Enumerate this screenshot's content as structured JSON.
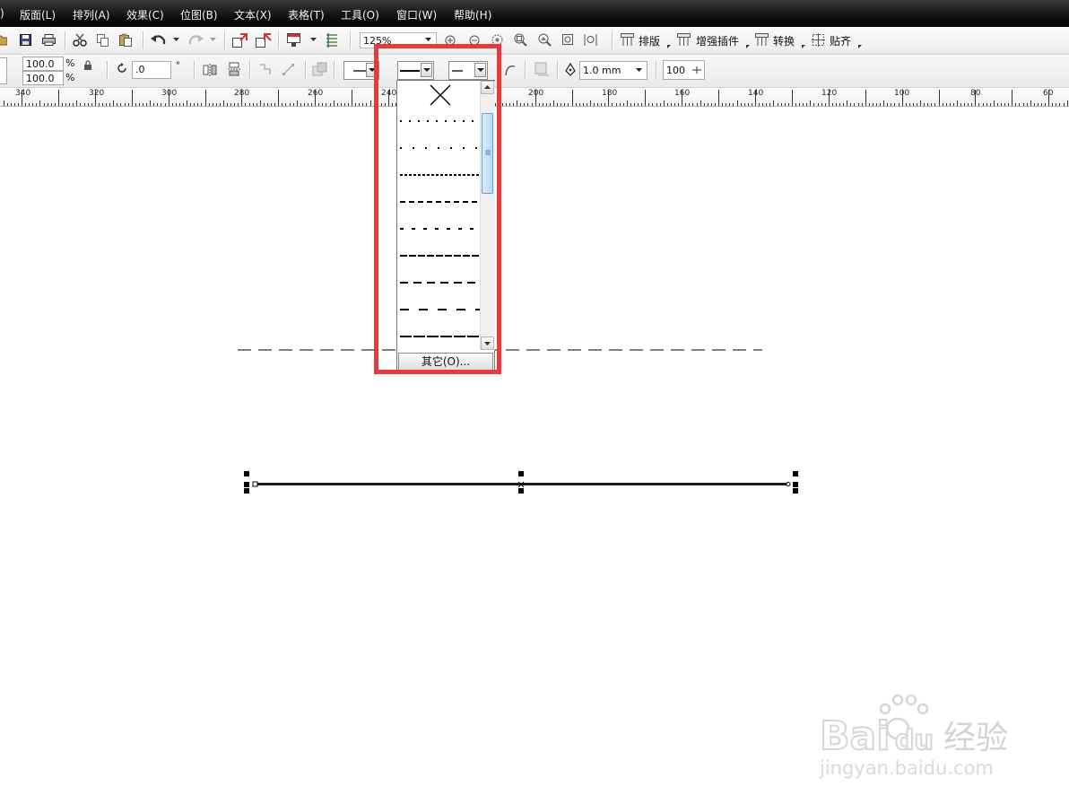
{
  "menu": {
    "items": [
      "版面(L)",
      "排列(A)",
      "效果(C)",
      "位图(B)",
      "文本(X)",
      "表格(T)",
      "工具(O)",
      "窗口(W)",
      "帮助(H)"
    ],
    "leading_fragment": ")"
  },
  "toolbar": {
    "zoom_value": "125%",
    "arrange_label": "排版",
    "plugins_label": "增强插件",
    "convert_label": "转换",
    "snap_label": "贴齐"
  },
  "property_bar": {
    "scale_x": "100.0",
    "scale_y": "100.0",
    "percent_symbol": "%",
    "rotation": ".0",
    "degree_symbol": "°",
    "outline_width": "1.0 mm",
    "opacity_value": "100"
  },
  "ruler": {
    "labels": [
      "340",
      "320",
      "300",
      "280",
      "260",
      "240",
      "200",
      "180",
      "160",
      "140",
      "120",
      "100",
      "80",
      "60"
    ]
  },
  "line_style_popup": {
    "styles": [
      "none",
      "dotted-fine",
      "dotted-sparse",
      "dotted-dense",
      "short-dash",
      "dash-dot-spaced",
      "long-dash",
      "medium-dash",
      "wide-dash",
      "solid-thick"
    ],
    "other_button_label": "其它(O)...",
    "highlight_color": "#e8393d"
  },
  "watermark": {
    "brand_letters": "Bai",
    "brand_suffix": "经验",
    "url": "jingyan.baidu.com"
  }
}
